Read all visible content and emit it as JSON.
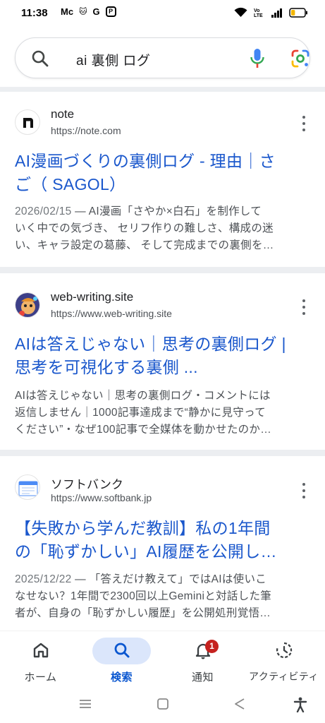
{
  "status_bar": {
    "time": "11:38",
    "apps": [
      "Mc",
      "🐱",
      "G",
      "P"
    ],
    "battery_level": 0.3
  },
  "search": {
    "query": "ai 裏側 ログ"
  },
  "results": [
    {
      "site_name": "note",
      "url": "https://note.com",
      "title_line1": "AI漫画づくりの裏側ログ - 理由｜さ",
      "title_line2": "ご（ SAGOL）",
      "date": "2026/02/15",
      "snippet_line1_rest": " — AI漫画「さやか×白石」を制作して",
      "snippet_line2": "いく中での気づき、 セリフ作りの難しさ、構成の迷",
      "snippet_line3": "い、キャラ設定の葛藤、 そして完成までの裏側を…"
    },
    {
      "site_name": "web-writing.site",
      "url": "https://www.web-writing.site",
      "title_line1": "AIは答えじゃない｜思考の裏側ログ |",
      "title_line2": "思考を可視化する裏側 ...",
      "date": "",
      "snippet_line1_rest": "AIは答えじゃない｜思考の裏側ログ・コメントには",
      "snippet_line2": "返信しません｜1000記事達成まで“静かに見守って",
      "snippet_line3": "ください”・なぜ100記事で全媒体を動かせたのか…"
    },
    {
      "site_name": "ソフトバンク",
      "url": "https://www.softbank.jp",
      "title_line1": "【失敗から学んだ教訓】私の1年間",
      "title_line2": "の「恥ずかしい」AI履歴を公開し…",
      "date": "2025/12/22",
      "snippet_line1_rest": " — 「答えだけ教えて」ではAIは使いこ",
      "snippet_line2": "なせない？1年間で2300回以上Geminiと対話した筆",
      "snippet_line3": "者が、自身の「恥ずかしい履歴」を公開処刑覚悟…"
    }
  ],
  "bottom_nav": {
    "items": [
      {
        "label": "ホーム",
        "icon": "home-icon"
      },
      {
        "label": "検索",
        "icon": "search-icon"
      },
      {
        "label": "通知",
        "icon": "bell-icon",
        "badge": "1"
      },
      {
        "label": "アクティビティ",
        "icon": "activity-icon"
      }
    ],
    "active": "検索"
  },
  "colors": {
    "link": "#1a57cc",
    "active_nav": "#0b57d0",
    "badge": "#c5221f"
  }
}
